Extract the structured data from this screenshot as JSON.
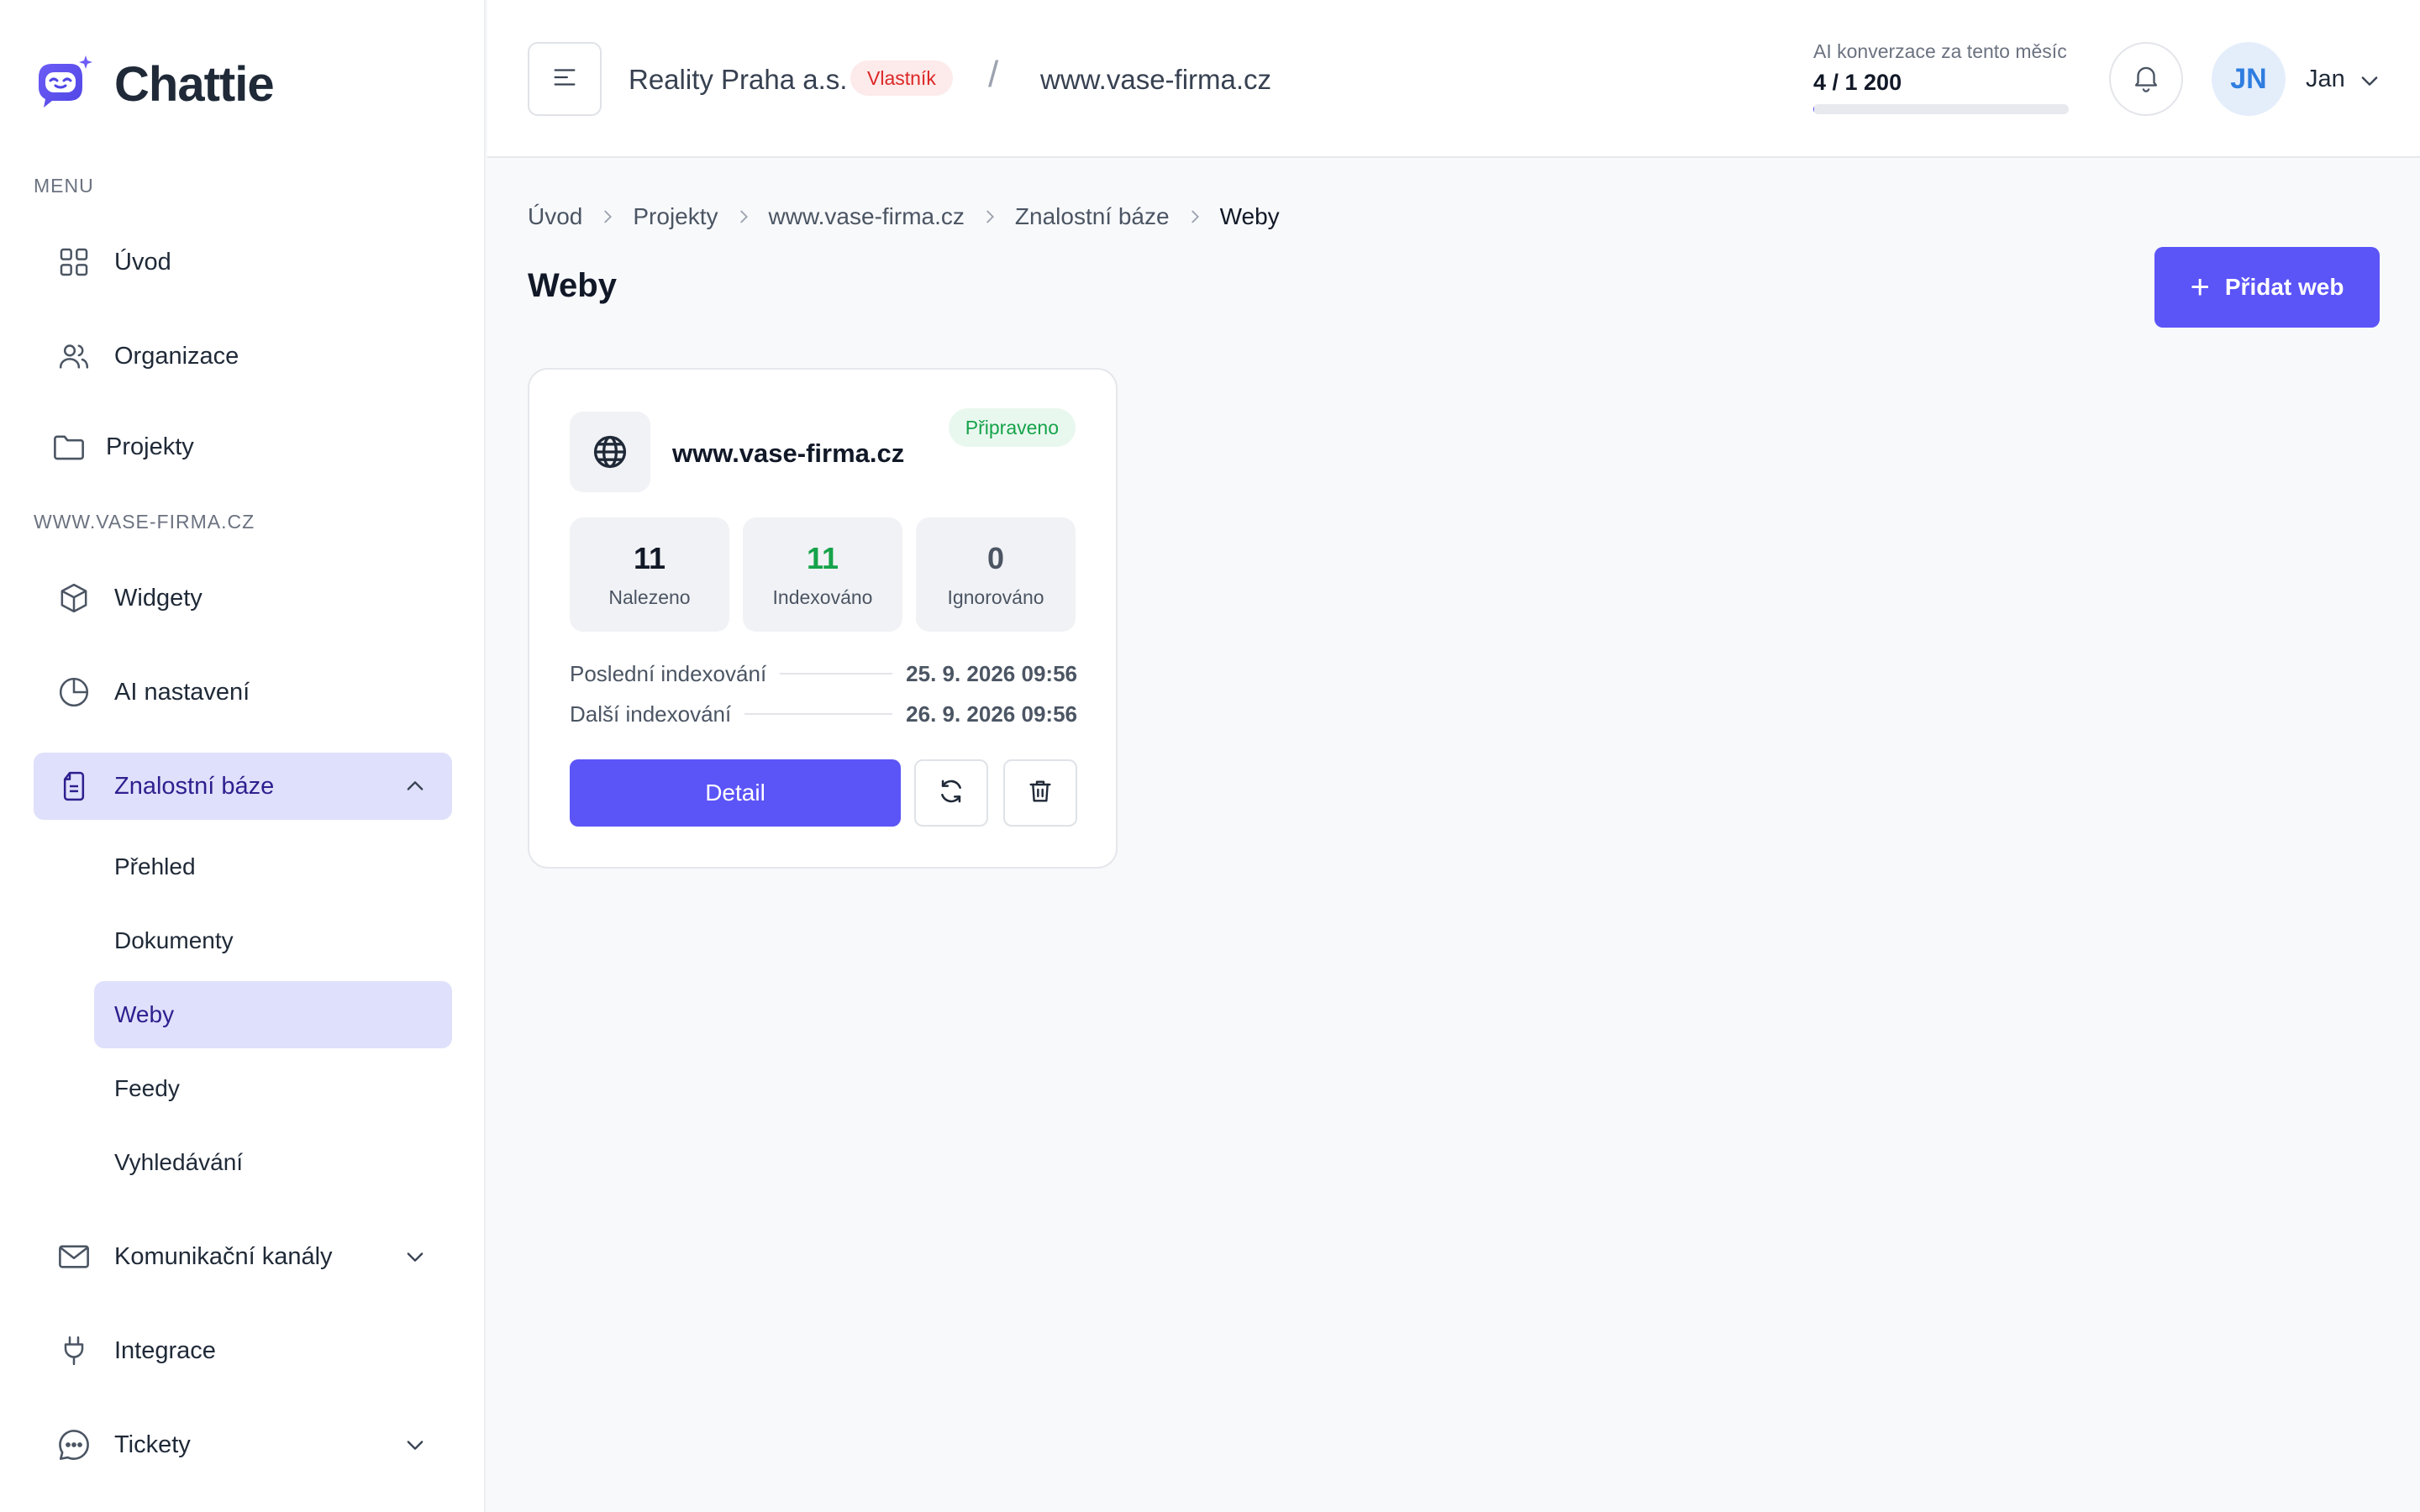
{
  "app": {
    "name": "Chattie"
  },
  "sidebar": {
    "menu_label": "MENU",
    "project_label": "WWW.VASE-FIRMA.CZ",
    "items": [
      {
        "label": "Úvod",
        "icon": "grid-icon"
      },
      {
        "label": "Organizace",
        "icon": "users-icon"
      },
      {
        "label": "Projekty",
        "icon": "folder-icon"
      },
      {
        "label": "Widgety",
        "icon": "cube-icon"
      },
      {
        "label": "AI nastavení",
        "icon": "pie-chart-icon"
      },
      {
        "label": "Znalostní báze",
        "icon": "document-icon",
        "expanded": true
      },
      {
        "label": "Komunikační kanály",
        "icon": "mail-icon"
      },
      {
        "label": "Integrace",
        "icon": "plug-icon"
      },
      {
        "label": "Tickety",
        "icon": "chat-icon"
      }
    ],
    "sub_items": [
      {
        "label": "Přehled"
      },
      {
        "label": "Dokumenty"
      },
      {
        "label": "Weby",
        "active": true
      },
      {
        "label": "Feedy"
      },
      {
        "label": "Vyhledávání"
      }
    ]
  },
  "header": {
    "org_name": "Reality Praha a.s.",
    "role_badge": "Vlastník",
    "separator": "/",
    "project": "www.vase-firma.cz",
    "usage_caption": "AI konverzace za tento měsíc",
    "usage_value": "4 / 1 200",
    "usage_fraction": 0.0033,
    "avatar_initials": "JN",
    "user_name": "Jan"
  },
  "breadcrumb": [
    "Úvod",
    "Projekty",
    "www.vase-firma.cz",
    "Znalostní báze",
    "Weby"
  ],
  "page": {
    "title": "Weby",
    "add_button": "Přidat web"
  },
  "card": {
    "site": "www.vase-firma.cz",
    "status": "Připraveno",
    "stats": [
      {
        "value": "11",
        "label": "Nalezeno",
        "color": "#111827"
      },
      {
        "value": "11",
        "label": "Indexováno",
        "color": "#16a34a"
      },
      {
        "value": "0",
        "label": "Ignorováno",
        "color": "#4b5563"
      }
    ],
    "last_index_label": "Poslední indexování",
    "last_index_value": "25. 9. 2026 09:56",
    "next_index_label": "Další indexování",
    "next_index_value": "26. 9. 2026 09:56",
    "detail_button": "Detail"
  },
  "colors": {
    "accent": "#5b54f7",
    "active_bg": "#dfe0fb",
    "success": "#16a34a",
    "danger": "#dc2626"
  }
}
